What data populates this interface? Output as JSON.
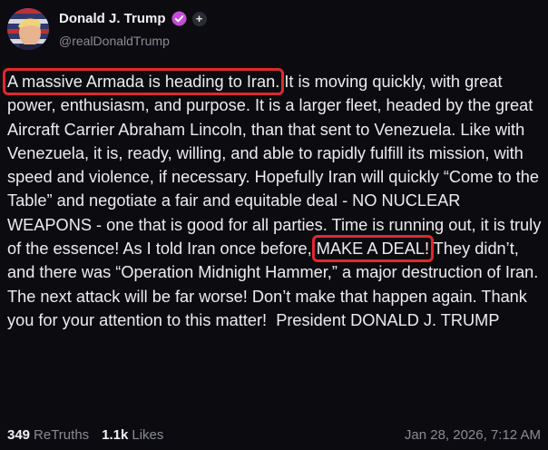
{
  "author": {
    "name": "Donald J. Trump",
    "handle": "@realDonaldTrump",
    "verified_color": "#c44bd6",
    "avatar_icon": "profile-photo"
  },
  "post": {
    "highlight1": "A massive Armada is heading to Iran.",
    "text1": " It is moving quickly, with great power, enthusiasm, and purpose. It is a larger fleet, headed by the great Aircraft Carrier Abraham Lincoln, than that sent to Venezuela. Like with Venezuela, it is, ready, willing, and able to rapidly fulfill its mission, with speed and violence, if necessary. Hopefully Iran will quickly “Come to the Table” and negotiate a fair and equitable deal - NO NUCLEAR WEAPONS - one that is good for all parties. Time is running out, it is truly of the essence! As I told Iran once before, ",
    "highlight2": "MAKE A DEAL!",
    "text2": " They didn’t, and there was “Operation Midnight Hammer,” a major destruction of Iran. The next attack will be far worse! Don’t make that happen again. Thank you for your attention to this matter!  President DONALD J. TRUMP",
    "highlight_color": "#e0282f"
  },
  "stats": {
    "retruths_count": "349",
    "retruths_label": "ReTruths",
    "likes_count": "1.1k",
    "likes_label": "Likes",
    "timestamp": "Jan 28, 2026, 7:12 AM"
  }
}
